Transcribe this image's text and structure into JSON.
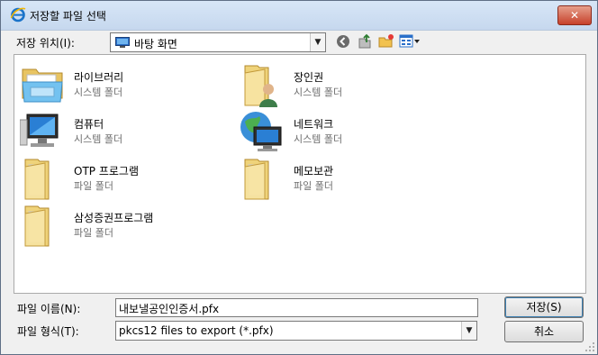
{
  "window": {
    "title": "저장할 파일 선택",
    "close_label": "✕"
  },
  "location": {
    "label": "저장 위치(I):",
    "value": "바탕 화면"
  },
  "files": [
    {
      "name": "라이브러리",
      "type": "시스템 폴더",
      "icon": "library-icon"
    },
    {
      "name": "장인권",
      "type": "시스템 폴더",
      "icon": "user-folder-icon"
    },
    {
      "name": "컴퓨터",
      "type": "시스템 폴더",
      "icon": "computer-icon"
    },
    {
      "name": "네트워크",
      "type": "시스템 폴더",
      "icon": "network-icon"
    },
    {
      "name": "OTP 프로그램",
      "type": "파일 폴더",
      "icon": "folder-icon"
    },
    {
      "name": "메모보관",
      "type": "파일 폴더",
      "icon": "folder-icon"
    },
    {
      "name": "삼성증권프로그램",
      "type": "파일 폴더",
      "icon": "folder-icon"
    }
  ],
  "filename": {
    "label": "파일 이름(N):",
    "value": "내보낼공인인증서.pfx"
  },
  "filetype": {
    "label": "파일 형식(T):",
    "value": "pkcs12 files to export (*.pfx)"
  },
  "buttons": {
    "save": "저장(S)",
    "cancel": "취소"
  }
}
